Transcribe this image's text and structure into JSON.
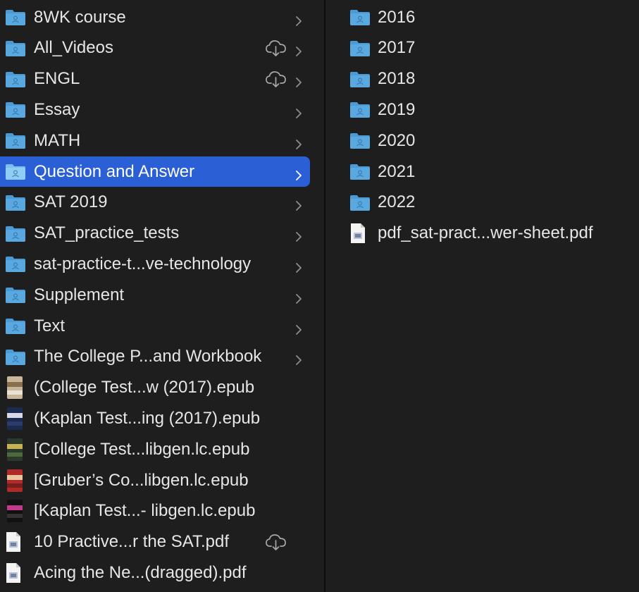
{
  "left_column": {
    "items": [
      {
        "label": "8WK course",
        "type": "folder",
        "chevron": true,
        "cloud": false
      },
      {
        "label": "All_Videos",
        "type": "folder",
        "chevron": true,
        "cloud": true
      },
      {
        "label": "ENGL",
        "type": "folder",
        "chevron": true,
        "cloud": true
      },
      {
        "label": "Essay",
        "type": "folder",
        "chevron": true,
        "cloud": false
      },
      {
        "label": "MATH",
        "type": "folder",
        "chevron": true,
        "cloud": false
      },
      {
        "label": "Question and Answer",
        "type": "folder",
        "chevron": true,
        "cloud": false,
        "selected": true
      },
      {
        "label": "SAT 2019",
        "type": "folder",
        "chevron": true,
        "cloud": false
      },
      {
        "label": "SAT_practice_tests",
        "type": "folder",
        "chevron": true,
        "cloud": false
      },
      {
        "label": "sat-practice-t...ve-technology",
        "type": "folder",
        "chevron": true,
        "cloud": false
      },
      {
        "label": "Supplement",
        "type": "folder",
        "chevron": true,
        "cloud": false
      },
      {
        "label": "Text",
        "type": "folder",
        "chevron": true,
        "cloud": false
      },
      {
        "label": "The College P...and Workbook",
        "type": "folder",
        "chevron": true,
        "cloud": false
      },
      {
        "label": "(College Test...w (2017).epub",
        "type": "epub",
        "chevron": false,
        "cloud": false
      },
      {
        "label": "(Kaplan Test...ing (2017).epub",
        "type": "epub",
        "chevron": false,
        "cloud": false
      },
      {
        "label": "[College Test...libgen.lc.epub",
        "type": "epub",
        "chevron": false,
        "cloud": false
      },
      {
        "label": "[Gruber’s Co...libgen.lc.epub",
        "type": "epub",
        "chevron": false,
        "cloud": false
      },
      {
        "label": "[Kaplan Test...- libgen.lc.epub",
        "type": "epub",
        "chevron": false,
        "cloud": false
      },
      {
        "label": "10 Practive...r the SAT.pdf",
        "type": "pdf",
        "chevron": false,
        "cloud": true
      },
      {
        "label": "Acing the Ne...(dragged).pdf",
        "type": "pdf",
        "chevron": false,
        "cloud": false
      }
    ]
  },
  "right_column": {
    "items": [
      {
        "label": "2016",
        "type": "folder"
      },
      {
        "label": "2017",
        "type": "folder"
      },
      {
        "label": "2018",
        "type": "folder"
      },
      {
        "label": "2019",
        "type": "folder"
      },
      {
        "label": "2020",
        "type": "folder"
      },
      {
        "label": "2021",
        "type": "folder"
      },
      {
        "label": "2022",
        "type": "folder"
      },
      {
        "label": "pdf_sat-pract...wer-sheet.pdf",
        "type": "pdf"
      }
    ]
  },
  "colors": {
    "background": "#1e1e1e",
    "selection": "#2a5fd6",
    "folder": "#5aa8e0",
    "text": "#e6e6e6",
    "chevron": "#8e8e8e"
  },
  "icons": {
    "folder": "folder-icon",
    "pdf": "pdf-file-icon",
    "epub": "epub-book-icon",
    "cloud": "cloud-download-icon",
    "chevron": "chevron-right-icon"
  }
}
